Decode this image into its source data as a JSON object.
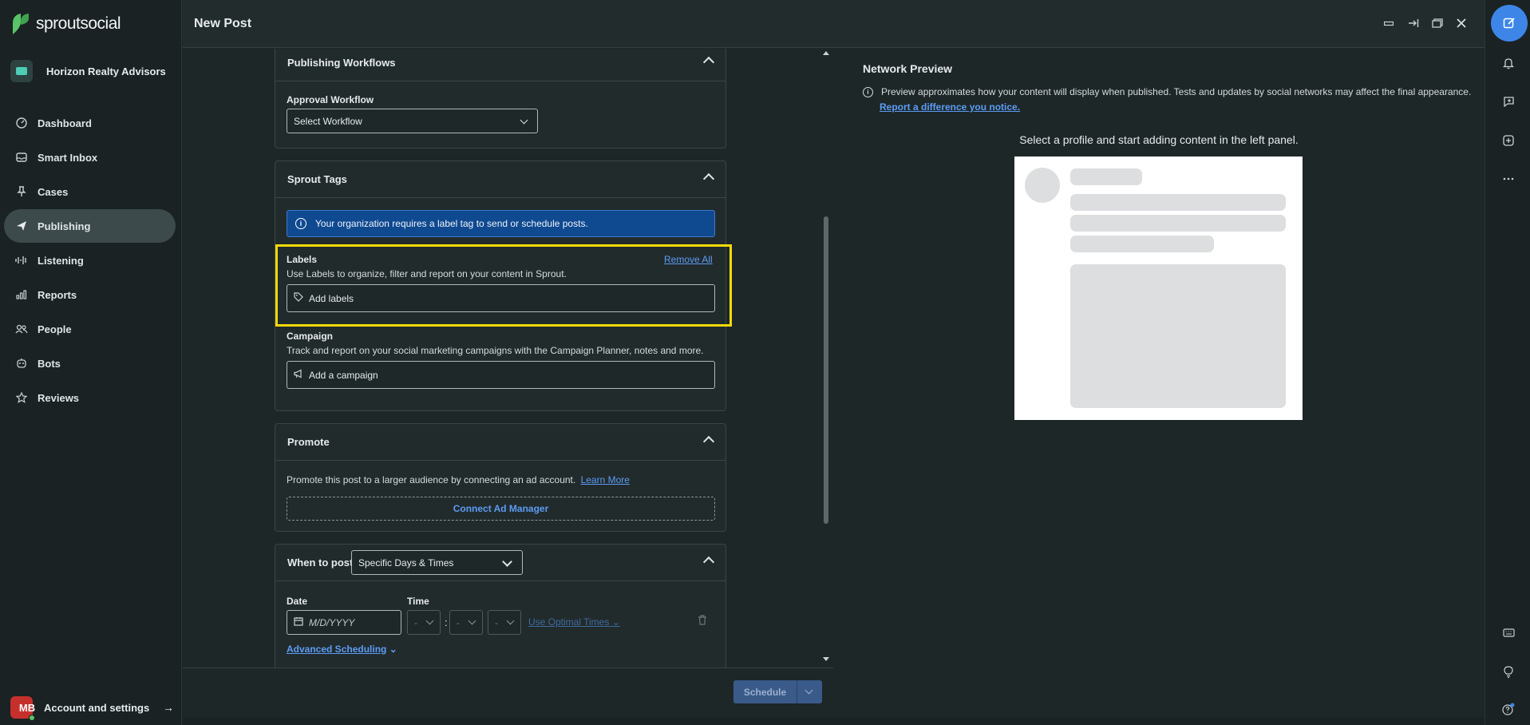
{
  "brand": {
    "name_bold": "sprout",
    "name_light": "social"
  },
  "org": {
    "name": "Horizon Realty Advisors"
  },
  "nav": {
    "items": [
      {
        "label": "Dashboard",
        "icon": "gauge-icon"
      },
      {
        "label": "Smart Inbox",
        "icon": "inbox-icon"
      },
      {
        "label": "Cases",
        "icon": "pin-icon"
      },
      {
        "label": "Publishing",
        "icon": "paper-plane-icon",
        "active": true
      },
      {
        "label": "Listening",
        "icon": "waveform-icon"
      },
      {
        "label": "Reports",
        "icon": "bar-chart-icon"
      },
      {
        "label": "People",
        "icon": "people-icon"
      },
      {
        "label": "Bots",
        "icon": "bot-icon"
      },
      {
        "label": "Reviews",
        "icon": "star-icon"
      }
    ]
  },
  "account": {
    "initials": "MB",
    "label": "Account and settings"
  },
  "header": {
    "title": "New Post"
  },
  "publishing_workflows": {
    "title": "Publishing Workflows",
    "approval_label": "Approval Workflow",
    "select_value": "Select Workflow"
  },
  "sprout_tags": {
    "title": "Sprout Tags",
    "banner": "Your organization requires a label tag to send or schedule posts.",
    "labels_title": "Labels",
    "remove_all": "Remove All",
    "labels_desc": "Use Labels to organize, filter and report on your content in Sprout.",
    "add_labels": "Add labels",
    "campaign_title": "Campaign",
    "campaign_desc": "Track and report on your social marketing campaigns with the Campaign Planner, notes and more.",
    "add_campaign": "Add a campaign"
  },
  "promote": {
    "title": "Promote",
    "desc": "Promote this post to a larger audience by connecting an ad account.",
    "learn_more": "Learn More",
    "connect": "Connect Ad Manager"
  },
  "when_to_post": {
    "title": "When to post",
    "mode": "Specific Days & Times",
    "date_label": "Date",
    "time_label": "Time",
    "date_placeholder": "M/D/YYYY",
    "hour": "-",
    "minute": "-",
    "ampm": "-",
    "colon": ":",
    "optimal": "Use Optimal Times",
    "advanced": "Advanced Scheduling"
  },
  "footer": {
    "schedule": "Schedule"
  },
  "preview": {
    "title": "Network Preview",
    "note": "Preview approximates how your content will display when published. Tests and updates by social networks may affect the final appearance.",
    "link": "Report a difference you notice.",
    "prompt": "Select a profile and start adding content in the left panel."
  },
  "colors": {
    "accent": "#3d86e8",
    "highlight": "#f5d90a",
    "banner": "#0f4990",
    "link": "#5c9cf5"
  }
}
